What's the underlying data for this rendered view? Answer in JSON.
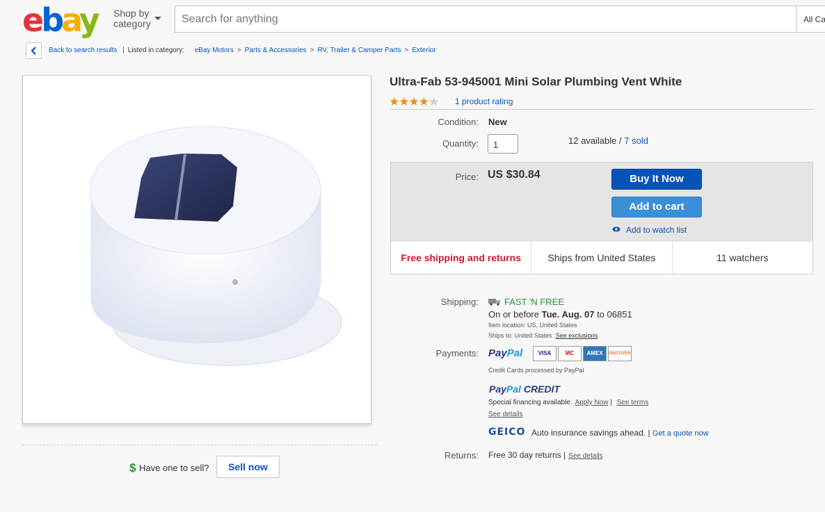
{
  "header": {
    "logo": {
      "e": "e",
      "b": "b",
      "a": "a",
      "y": "y"
    },
    "shop_by_line1": "Shop by",
    "shop_by_line2": "category",
    "search_placeholder": "Search for anything",
    "category_select": "All Ca"
  },
  "breadcrumb": {
    "back": "Back to search results",
    "listed_in": "Listed in category:",
    "items": [
      "eBay Motors",
      "Parts & Accessories",
      "RV, Trailer & Camper Parts",
      "Exterior"
    ],
    "separator": ">"
  },
  "product": {
    "title": "Ultra-Fab 53-945001 Mini Solar Plumbing Vent White",
    "rating_stars": 4,
    "rating_max": 5,
    "rating_link": "1 product rating",
    "condition_label": "Condition:",
    "condition_value": "New",
    "quantity_label": "Quantity:",
    "quantity_value": "1",
    "available": "12 available /",
    "sold": "7 sold"
  },
  "pricing": {
    "price_label": "Price:",
    "price_value": "US $30.84",
    "buy_now": "Buy It Now",
    "add_to_cart": "Add to cart",
    "watch_list": "Add to watch list",
    "strip": [
      "Free shipping and returns",
      "Ships from United States",
      "11 watchers"
    ]
  },
  "shipping": {
    "label": "Shipping:",
    "fast_free": "FAST 'N FREE",
    "deliver_prefix": "On or before",
    "deliver_date": "Tue. Aug. 07",
    "deliver_suffix": "to 06851",
    "item_location": "Item location:  US, United States",
    "ships_to": "Ships to:  United States",
    "see_exclusions": "See exclusions"
  },
  "payments": {
    "label": "Payments:",
    "paypal_1": "Pay",
    "paypal_2": "Pal",
    "cards": [
      "VISA",
      "MC",
      "AMEX",
      "DISCOVER"
    ],
    "cc_note": "Credit Cards processed by PayPal",
    "credit_1": "Pay",
    "credit_2": "Pal",
    "credit_3": " CREDIT",
    "special": "Special financing available.",
    "apply_now": "Apply Now",
    "pipe": "|",
    "see_terms": "See terms",
    "see_details": "See details",
    "geico": "GEICO",
    "geico_text": "Auto insurance savings ahead. |",
    "geico_link": "Get a quote now"
  },
  "returns": {
    "label": "Returns:",
    "value": "Free 30 day returns |",
    "see_details": "See details"
  },
  "sell": {
    "dollar": "$",
    "have_one": "Have one to sell?",
    "sell_now": "Sell now"
  },
  "colors": {
    "ebay_red": "#e53238",
    "ebay_blue": "#0064d2",
    "ebay_yellow": "#f5af02",
    "ebay_green": "#86b817",
    "link": "#0654ba",
    "free_shipping": "#c91a2b",
    "fast_free": "#2a8f2a",
    "star": "#f18c0e"
  }
}
